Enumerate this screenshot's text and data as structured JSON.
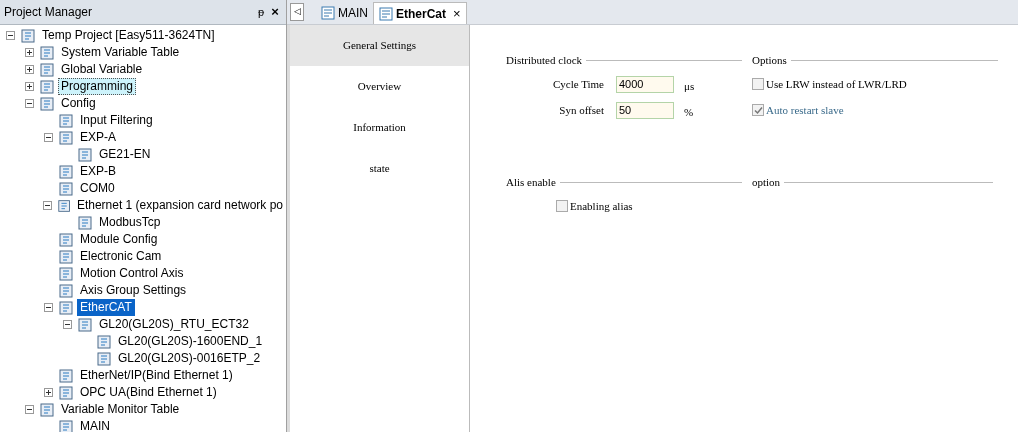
{
  "project_panel": {
    "title": "Project Manager",
    "pin": "ᵽ",
    "close": "×"
  },
  "tree": [
    {
      "label": "Temp Project [Easy511-3624TN]",
      "expanded": true,
      "selected": false,
      "highlighted": false,
      "children": [
        {
          "label": "System Variable Table",
          "expanded": false,
          "selected": false,
          "highlighted": false
        },
        {
          "label": "Global Variable",
          "expanded": false,
          "selected": false,
          "highlighted": false
        },
        {
          "label": "Programming",
          "expanded": false,
          "selected": false,
          "highlighted": true
        },
        {
          "label": "Config",
          "expanded": true,
          "selected": false,
          "highlighted": false,
          "children": [
            {
              "label": "Input Filtering",
              "selected": false,
              "highlighted": false
            },
            {
              "label": "EXP-A",
              "expanded": true,
              "selected": false,
              "highlighted": false,
              "children": [
                {
                  "label": "GE21-EN",
                  "selected": false,
                  "highlighted": false
                }
              ]
            },
            {
              "label": "EXP-B",
              "selected": false,
              "highlighted": false
            },
            {
              "label": "COM0",
              "selected": false,
              "highlighted": false
            },
            {
              "label": "Ethernet 1 (expansion card network po",
              "expanded": true,
              "selected": false,
              "highlighted": false,
              "children": [
                {
                  "label": "ModbusTcp",
                  "selected": false,
                  "highlighted": false
                }
              ]
            },
            {
              "label": "Module Config",
              "selected": false,
              "highlighted": false
            },
            {
              "label": "Electronic Cam",
              "selected": false,
              "highlighted": false
            },
            {
              "label": "Motion Control Axis",
              "selected": false,
              "highlighted": false
            },
            {
              "label": "Axis Group Settings",
              "selected": false,
              "highlighted": false
            },
            {
              "label": "EtherCAT",
              "expanded": true,
              "selected": true,
              "highlighted": false,
              "children": [
                {
                  "label": "GL20(GL20S)_RTU_ECT32",
                  "expanded": true,
                  "selected": false,
                  "highlighted": false,
                  "children": [
                    {
                      "label": "GL20(GL20S)-1600END_1",
                      "selected": false,
                      "highlighted": false
                    },
                    {
                      "label": "GL20(GL20S)-0016ETP_2",
                      "selected": false,
                      "highlighted": false
                    }
                  ]
                }
              ]
            },
            {
              "label": "EtherNet/IP(Bind Ethernet 1)",
              "selected": false,
              "highlighted": false
            },
            {
              "label": "OPC UA(Bind Ethernet 1)",
              "expanded": false,
              "selected": false,
              "highlighted": false
            }
          ]
        },
        {
          "label": "Variable Monitor Table",
          "expanded": true,
          "selected": false,
          "highlighted": false,
          "children": [
            {
              "label": "MAIN",
              "selected": false,
              "highlighted": false
            }
          ]
        }
      ]
    }
  ],
  "tab_scroll": "◁",
  "tabs": [
    {
      "label": "MAIN",
      "selected": false
    },
    {
      "label": "EtherCat",
      "selected": true,
      "close": "×"
    }
  ],
  "nav": [
    {
      "label": "General Settings",
      "selected": true
    },
    {
      "label": "Overview",
      "selected": false
    },
    {
      "label": "Information",
      "selected": false
    },
    {
      "label": "state",
      "selected": false
    }
  ],
  "distributed_clock": {
    "title": "Distributed clock",
    "fields": [
      {
        "label": "Cycle Time",
        "value": "4000",
        "unit": "μs"
      },
      {
        "label": "Syn offset",
        "value": "50",
        "unit": "%"
      }
    ]
  },
  "options": {
    "title": "Options",
    "checkboxes": [
      {
        "label": "Use LRW instead of LWR/LRD",
        "checked": false,
        "disabled": false
      },
      {
        "label": "Auto restart slave",
        "checked": true,
        "disabled": true
      }
    ]
  },
  "alias": {
    "title": "Alis enable",
    "checkboxes": [
      {
        "label": "Enabling alias",
        "checked": false,
        "disabled": false
      }
    ]
  },
  "option": {
    "title": "option"
  }
}
